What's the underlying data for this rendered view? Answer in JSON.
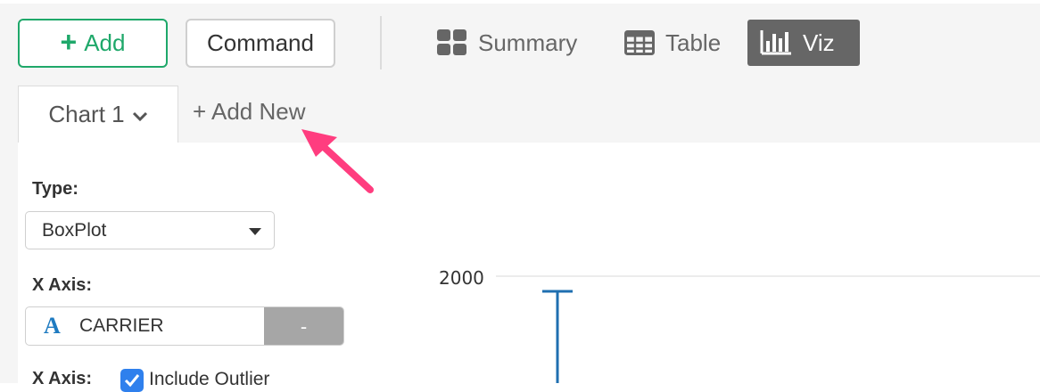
{
  "toolbar": {
    "add_label": "Add",
    "command_label": "Command"
  },
  "views": [
    {
      "label": "Summary",
      "icon": "grid-icon"
    },
    {
      "label": "Table",
      "icon": "table-icon"
    },
    {
      "label": "Viz",
      "icon": "bar-chart-icon",
      "active": true
    }
  ],
  "tabs": {
    "chart_tab_label": "Chart 1",
    "add_new_label": "+ Add New"
  },
  "settings": {
    "type_label": "Type:",
    "type_value": "BoxPlot",
    "x_axis_label": "X Axis:",
    "x_axis_column": "CARRIER",
    "x_axis_type_icon": "A",
    "x_axis_remove_label": "-",
    "x_axis_label_2": "X Axis:",
    "include_outlier_label": "Include Outlier",
    "include_outlier_checked": true
  },
  "chart_data": {
    "type": "box",
    "y_tick_labels": [
      "2000"
    ],
    "series_color": "#1f6fb0"
  },
  "colors": {
    "accent_green": "#1fa86a",
    "active_tab_bg": "#666666",
    "checkbox_blue": "#2f80ed",
    "annotation_arrow": "#ff3d7f"
  }
}
